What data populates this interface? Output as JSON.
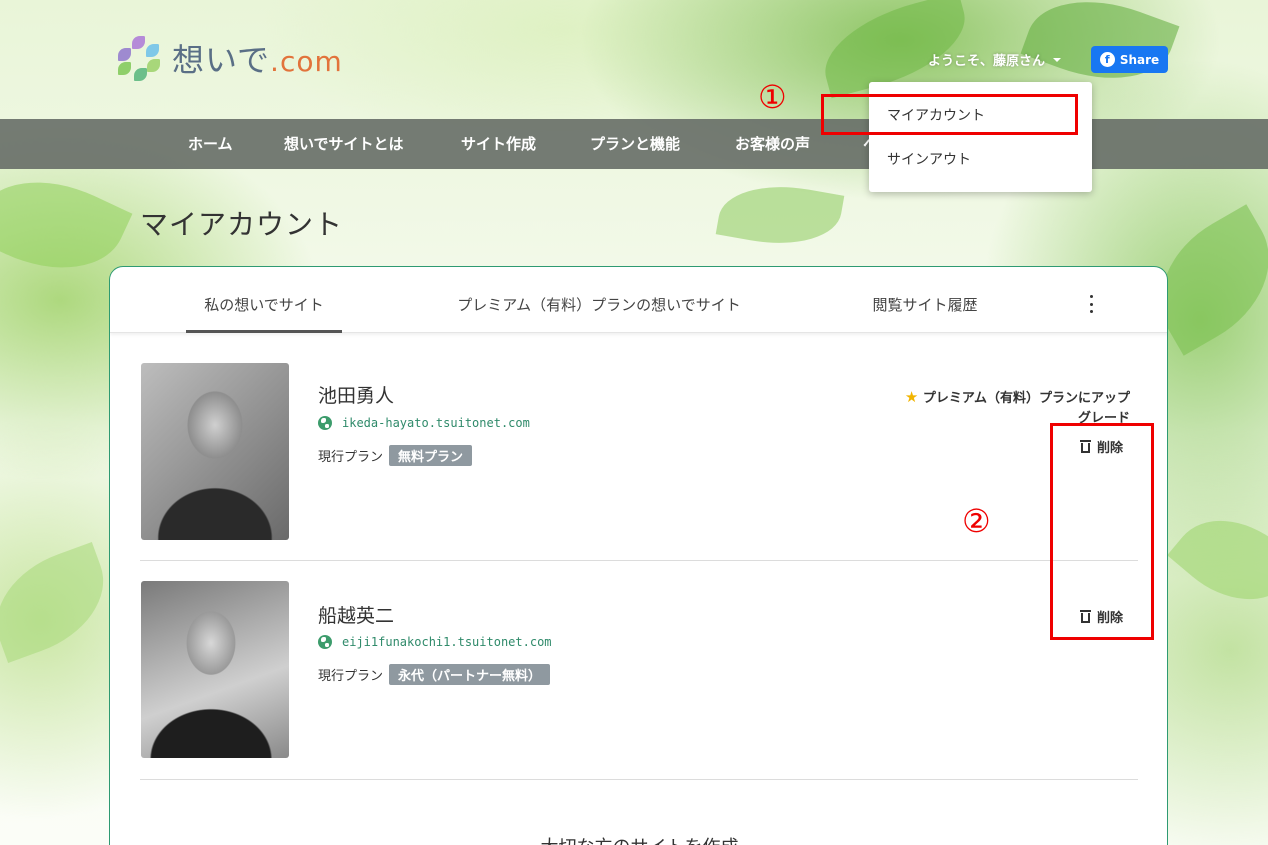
{
  "header": {
    "logo_text": "想いで",
    "logo_suffix": ".com",
    "welcome": "ようこそ、藤原さん",
    "share_label": "Share",
    "facebook_glyph": "f"
  },
  "nav": {
    "items": [
      "ホーム",
      "想いでサイトとは",
      "サイト作成",
      "プランと機能",
      "お客様の声",
      "ヘ"
    ]
  },
  "dropdown": {
    "items": [
      "マイアカウント",
      "サインアウト"
    ]
  },
  "page": {
    "title": "マイアカウント"
  },
  "tabs": [
    "私の想いでサイト",
    "プレミアム（有料）プランの想いでサイト",
    "閲覧サイト履歴"
  ],
  "sites": [
    {
      "name": "池田勇人",
      "url": "ikeda-hayato.tsuitonet.com",
      "plan_label": "現行プラン",
      "plan": "無料プラン",
      "upgrade": "プレミアム（有料）プランにアップグレード",
      "delete": "削除"
    },
    {
      "name": "船越英二",
      "url": "eiji1funakochi1.tsuitonet.com",
      "plan_label": "現行プラン",
      "plan": "永代（パートナー無料）",
      "delete": "削除"
    }
  ],
  "bottom": {
    "text": "大切な方のサイトを作成"
  },
  "annotations": {
    "mark1": "①",
    "mark2": "②"
  },
  "colors": {
    "accent": "#2e9a72",
    "facebook": "#1877f2",
    "annotation": "#ef0000",
    "nav_bg": "#696f69"
  },
  "icons": [
    "logo-icon",
    "caret-down-icon",
    "facebook-icon",
    "more-vertical-icon",
    "globe-icon",
    "star-icon",
    "trash-icon"
  ]
}
